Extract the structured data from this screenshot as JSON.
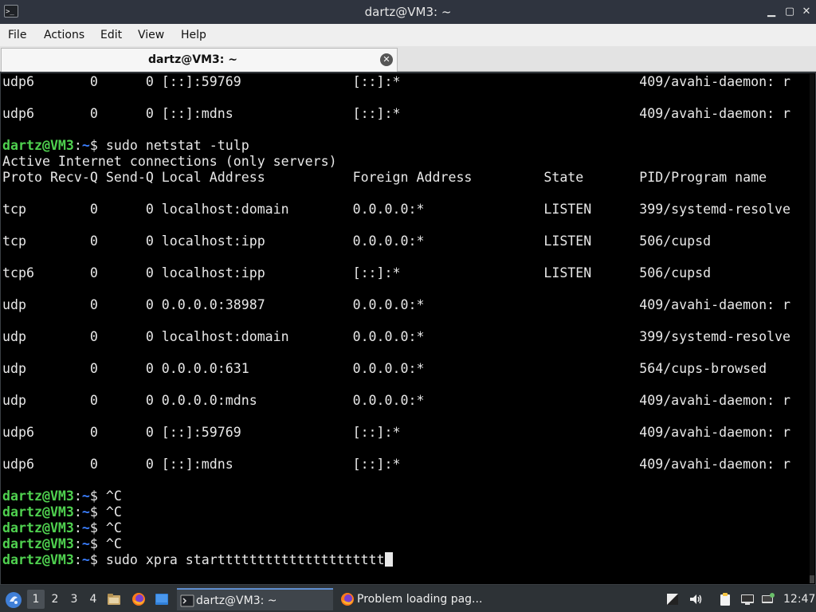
{
  "window": {
    "title": "dartz@VM3: ~",
    "app_icon_text": ">_",
    "minimize_glyph": "▁",
    "maximize_glyph": "▢",
    "close_glyph": "✕"
  },
  "menubar": {
    "items": [
      "File",
      "Actions",
      "Edit",
      "View",
      "Help"
    ]
  },
  "tabs": [
    {
      "label": "dartz@VM3: ~",
      "close_glyph": "✕"
    }
  ],
  "terminal": {
    "prompt_user": "dartz@VM3",
    "prompt_sep": ":",
    "prompt_path": "~",
    "prompt_end": "$ ",
    "lines": [
      {
        "text": "udp6       0      0 [::]:59769              [::]:*                              409/avahi-daemon: r"
      },
      {
        "text": ""
      },
      {
        "text": "udp6       0      0 [::]:mdns               [::]:*                              409/avahi-daemon: r"
      },
      {
        "text": ""
      },
      {
        "prompt": true,
        "text": "sudo netstat -tulp"
      },
      {
        "text": "Active Internet connections (only servers)"
      },
      {
        "text": "Proto Recv-Q Send-Q Local Address           Foreign Address         State       PID/Program name"
      },
      {
        "text": ""
      },
      {
        "text": "tcp        0      0 localhost:domain        0.0.0.0:*               LISTEN      399/systemd-resolve"
      },
      {
        "text": ""
      },
      {
        "text": "tcp        0      0 localhost:ipp           0.0.0.0:*               LISTEN      506/cupsd"
      },
      {
        "text": ""
      },
      {
        "text": "tcp6       0      0 localhost:ipp           [::]:*                  LISTEN      506/cupsd"
      },
      {
        "text": ""
      },
      {
        "text": "udp        0      0 0.0.0.0:38987           0.0.0.0:*                           409/avahi-daemon: r"
      },
      {
        "text": ""
      },
      {
        "text": "udp        0      0 localhost:domain        0.0.0.0:*                           399/systemd-resolve"
      },
      {
        "text": ""
      },
      {
        "text": "udp        0      0 0.0.0.0:631             0.0.0.0:*                           564/cups-browsed"
      },
      {
        "text": ""
      },
      {
        "text": "udp        0      0 0.0.0.0:mdns            0.0.0.0:*                           409/avahi-daemon: r"
      },
      {
        "text": ""
      },
      {
        "text": "udp6       0      0 [::]:59769              [::]:*                              409/avahi-daemon: r"
      },
      {
        "text": ""
      },
      {
        "text": "udp6       0      0 [::]:mdns               [::]:*                              409/avahi-daemon: r"
      },
      {
        "text": ""
      },
      {
        "prompt": true,
        "text": "^C"
      },
      {
        "prompt": true,
        "text": "^C"
      },
      {
        "prompt": true,
        "text": "^C"
      },
      {
        "prompt": true,
        "text": "^C"
      },
      {
        "prompt": true,
        "text": "sudo xpra starttttttttttttttttttttt",
        "cursor": true
      }
    ]
  },
  "taskbar": {
    "workspaces": [
      "1",
      "2",
      "3",
      "4"
    ],
    "active_workspace": "1",
    "tasks": [
      {
        "label": "dartz@VM3: ~",
        "icon": "terminal-icon",
        "active": true
      },
      {
        "label": "Problem loading pag...",
        "icon": "firefox-icon",
        "active": false
      }
    ],
    "clock": "12:47",
    "colors": {
      "accent": "#5f8fd0",
      "prompt_green": "#4fd14f",
      "prompt_blue": "#3b7fff"
    }
  }
}
